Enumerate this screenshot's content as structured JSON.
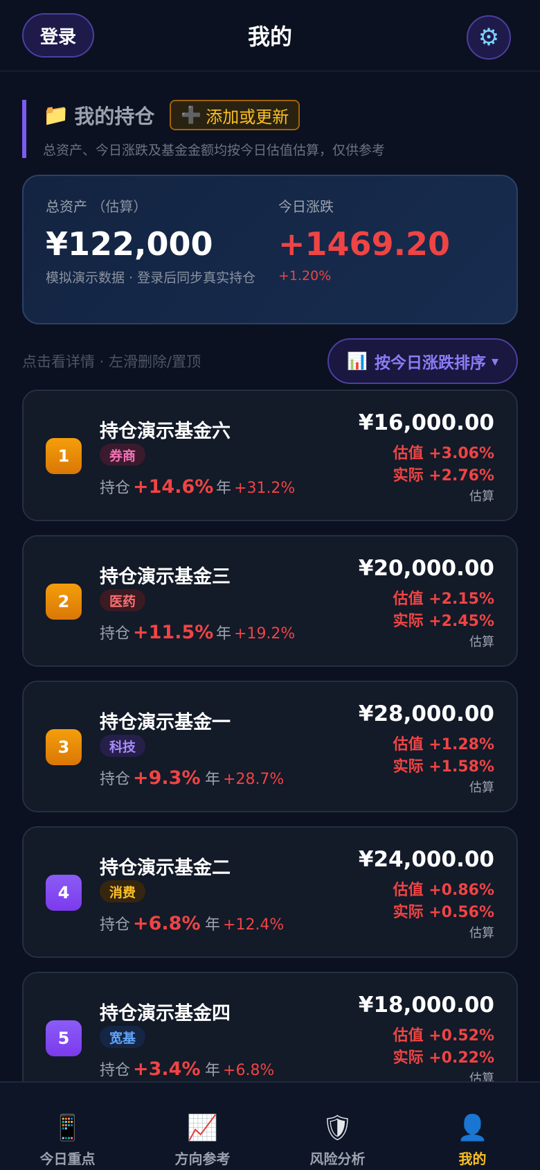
{
  "header": {
    "login_label": "登录",
    "title": "我的",
    "settings_icon": "gear-icon"
  },
  "holdings": {
    "title": "我的持仓",
    "add_label": "添加或更新",
    "subtitle": "总资产、今日涨跌及基金金额均按今日估值估算，仅供参考"
  },
  "summary": {
    "total_label": "总资产",
    "total_label_sub": "（估算）",
    "total_value": "¥122,000",
    "total_note": "模拟演示数据 · 登录后同步真实持仓",
    "change_label": "今日涨跌",
    "change_value": "+1469.20",
    "change_pct": "+1.20%"
  },
  "list_hint": "点击看详情 · 左滑删除/置顶",
  "sort": {
    "label": "按今日涨跌排序",
    "caret": "▾"
  },
  "funds": [
    {
      "rank": "1",
      "name": "持仓演示基金六",
      "tag": "券商",
      "hold_label": "持仓",
      "hold_pct": "+14.6%",
      "year_label": "年",
      "year_pct": "+31.2%",
      "amount": "¥16,000.00",
      "est": "估值 +3.06%",
      "act": "实际 +2.76%",
      "calc": "估算"
    },
    {
      "rank": "2",
      "name": "持仓演示基金三",
      "tag": "医药",
      "hold_label": "持仓",
      "hold_pct": "+11.5%",
      "year_label": "年",
      "year_pct": "+19.2%",
      "amount": "¥20,000.00",
      "est": "估值 +2.15%",
      "act": "实际 +2.45%",
      "calc": "估算"
    },
    {
      "rank": "3",
      "name": "持仓演示基金一",
      "tag": "科技",
      "hold_label": "持仓",
      "hold_pct": "+9.3%",
      "year_label": "年",
      "year_pct": "+28.7%",
      "amount": "¥28,000.00",
      "est": "估值 +1.28%",
      "act": "实际 +1.58%",
      "calc": "估算"
    },
    {
      "rank": "4",
      "name": "持仓演示基金二",
      "tag": "消费",
      "hold_label": "持仓",
      "hold_pct": "+6.8%",
      "year_label": "年",
      "year_pct": "+12.4%",
      "amount": "¥24,000.00",
      "est": "估值 +0.86%",
      "act": "实际 +0.56%",
      "calc": "估算"
    },
    {
      "rank": "5",
      "name": "持仓演示基金四",
      "tag": "宽基",
      "hold_label": "持仓",
      "hold_pct": "+3.4%",
      "year_label": "年",
      "year_pct": "+6.8%",
      "amount": "¥18,000.00",
      "est": "估值 +0.52%",
      "act": "实际 +0.22%",
      "calc": "估算"
    }
  ],
  "nav": [
    {
      "label": "今日重点",
      "icon": "phone-icon"
    },
    {
      "label": "方向参考",
      "icon": "trend-chart-icon"
    },
    {
      "label": "风险分析",
      "icon": "shield-icon"
    },
    {
      "label": "我的",
      "icon": "user-icon",
      "active": true
    }
  ],
  "colors": {
    "background": "#0b1120",
    "accent_purple": "#7c5cf0",
    "rise_red": "#ef4444",
    "active_gold": "#fbbf24"
  }
}
